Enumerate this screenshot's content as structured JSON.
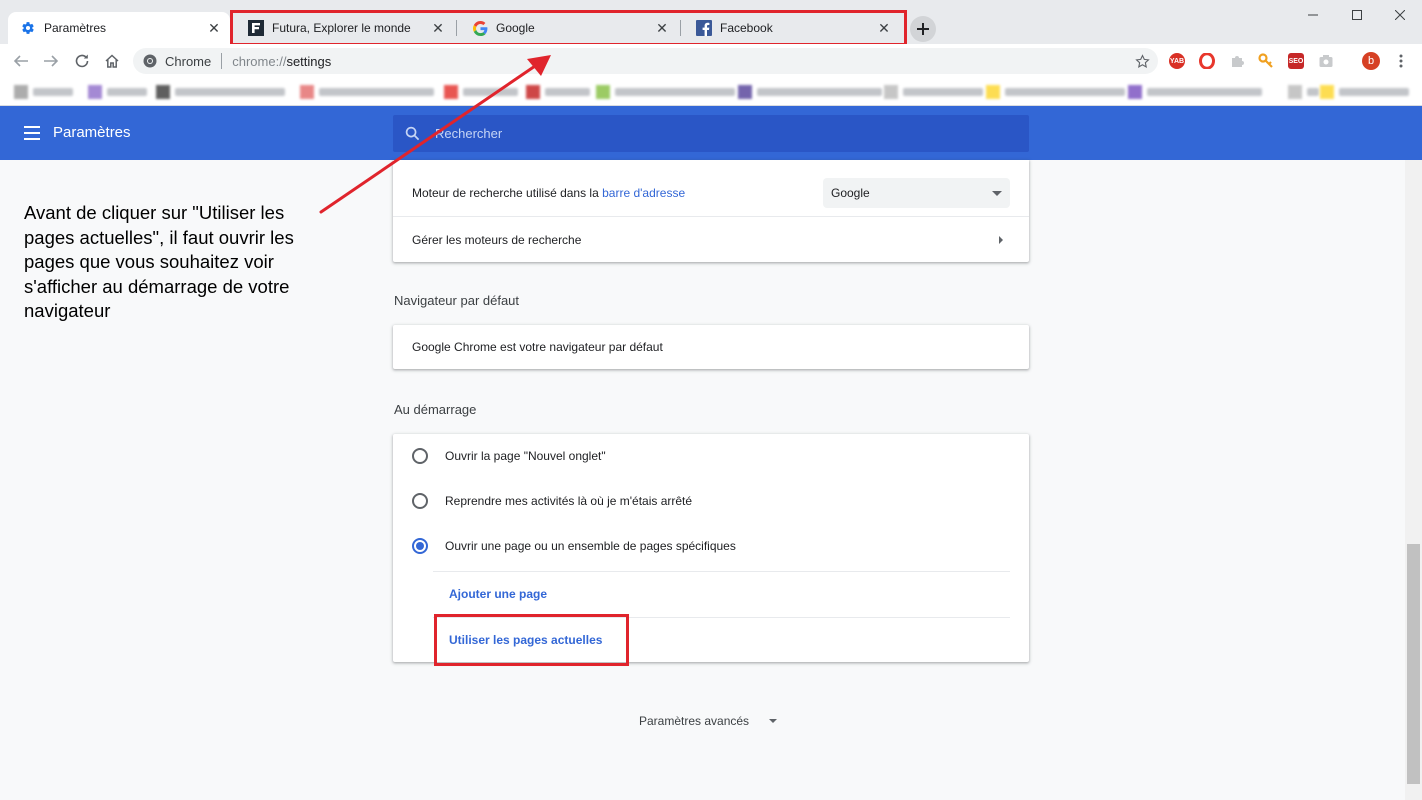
{
  "tabs": [
    {
      "title": "Paramètres",
      "icon": "gear-icon",
      "active": true
    },
    {
      "title": "Futura, Explorer le monde",
      "icon": "futura-logo-icon",
      "active": false
    },
    {
      "title": "Google",
      "icon": "google-logo-icon",
      "active": false
    },
    {
      "title": "Facebook",
      "icon": "facebook-logo-icon",
      "active": false
    }
  ],
  "toolbar": {
    "origin_label": "Chrome",
    "url_scheme": "chrome://",
    "url_path": "settings",
    "avatar_letter": "b"
  },
  "extensions": [
    {
      "name": "yab-extension-icon",
      "label": "YAB",
      "color": "#d93025"
    },
    {
      "name": "opera-extension-icon",
      "label": "O",
      "color": "#e8372c"
    },
    {
      "name": "puzzle-extension-icon",
      "label": "",
      "color": "#c8cacc"
    },
    {
      "name": "key-extension-icon",
      "label": "",
      "color": "#f0a020"
    },
    {
      "name": "seo-extension-icon",
      "label": "SEO",
      "color": "#c62828"
    },
    {
      "name": "camera-extension-icon",
      "label": "",
      "color": "#c8cacc"
    }
  ],
  "header": {
    "title": "Paramètres",
    "search_placeholder": "Rechercher"
  },
  "search_engine": {
    "label_prefix": "Moteur de recherche utilisé dans la ",
    "label_link": "barre d'adresse",
    "selected": "Google",
    "manage_label": "Gérer les moteurs de recherche"
  },
  "default_browser": {
    "section_title": "Navigateur par défaut",
    "status": "Google Chrome est votre navigateur par défaut"
  },
  "startup": {
    "section_title": "Au démarrage",
    "options": [
      {
        "label": "Ouvrir la page \"Nouvel onglet\"",
        "checked": false
      },
      {
        "label": "Reprendre mes activités là où je m'étais arrêté",
        "checked": false
      },
      {
        "label": "Ouvrir une page ou un ensemble de pages spécifiques",
        "checked": true
      }
    ],
    "add_page": "Ajouter une page",
    "use_current": "Utiliser les pages actuelles"
  },
  "advanced": {
    "label": "Paramètres avancés"
  },
  "annotation": {
    "text": "Avant de cliquer sur \"Utiliser les pages actuelles\", il faut ouvrir les pages que vous souhaitez voir s'afficher au démarrage de votre navigateur",
    "color": "#e0242c"
  },
  "colors": {
    "accent": "#3367d6",
    "header": "#3367d6",
    "highlight": "#e0242c"
  }
}
